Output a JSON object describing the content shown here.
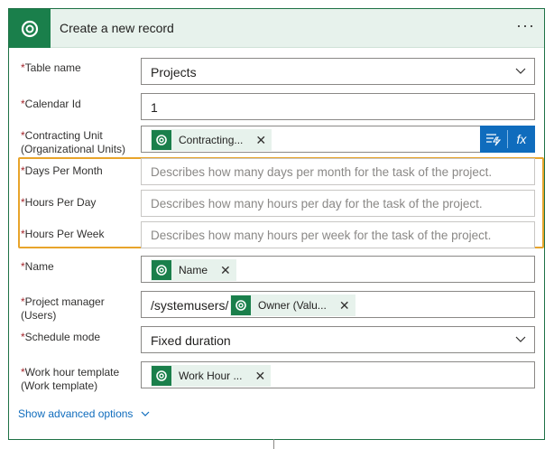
{
  "card": {
    "title": "Create a new record",
    "more_label": "···"
  },
  "fields": {
    "table_name": {
      "label": "Table name",
      "value": "Projects"
    },
    "calendar_id": {
      "label": "Calendar Id",
      "value": "1"
    },
    "contracting_unit": {
      "label_line1": "Contracting Unit",
      "label_line2": "(Organizational Units)",
      "token": "Contracting..."
    },
    "days_per_month": {
      "label": "Days Per Month",
      "placeholder": "Describes how many days per month for the task of the project."
    },
    "hours_per_day": {
      "label": "Hours Per Day",
      "placeholder": "Describes how many hours per day for the task of the project."
    },
    "hours_per_week": {
      "label": "Hours Per Week",
      "placeholder": "Describes how many hours per week for the task of the project."
    },
    "name": {
      "label": "Name",
      "token": "Name"
    },
    "project_manager": {
      "label_line1": "Project manager",
      "label_line2": "(Users)",
      "prefix": "/systemusers/",
      "token": "Owner (Valu..."
    },
    "schedule_mode": {
      "label": "Schedule mode",
      "value": "Fixed duration"
    },
    "work_hour_template": {
      "label_line1": "Work hour template",
      "label_line2": "(Work template)",
      "token": "Work Hour ..."
    }
  },
  "required_marker": "*",
  "token_remove": "✕",
  "dynamic_content": {
    "expression_label": "fx"
  },
  "advanced_options": "Show advanced options",
  "colors": {
    "accent_green": "#1a7f4b",
    "header_bg": "#e7f2ec",
    "highlight": "#e8a42b",
    "link_blue": "#0f6cbd",
    "required_red": "#a4262c"
  }
}
